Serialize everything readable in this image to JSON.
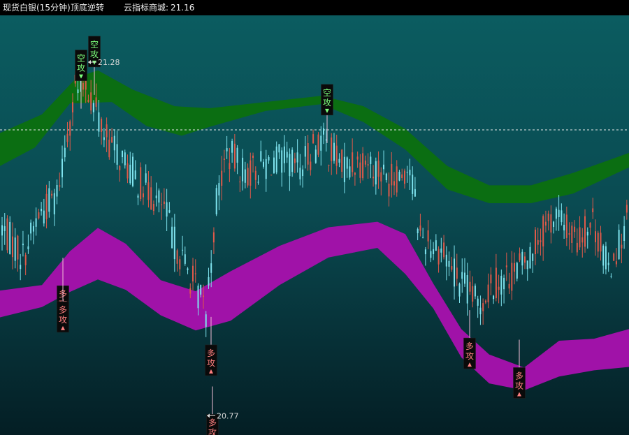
{
  "header": {
    "instrument": "现货白银(15分钟)",
    "indicator": "顶底逆转",
    "source_label": "云指标商城:",
    "source_value": "21.16"
  },
  "chart_data": {
    "type": "candlestick",
    "last_price": 21.16,
    "visible_high": 21.28,
    "visible_low": 20.77,
    "ylim": [
      20.74,
      21.35
    ],
    "grid": false,
    "colors": {
      "background_top": "#0b5c60",
      "background_bottom": "#041e24",
      "up_candle": "#e05a4a",
      "down_candle": "#7fe3ee",
      "upper_cloud": "#0b6e12",
      "lower_cloud": "#a012a8",
      "signal_text_bearish": "#7cff7c",
      "signal_text_bullish": "#ff8080",
      "signal_box": "#0a0a0a"
    },
    "upper_cloud": {
      "top": [
        [
          0,
          21.179
        ],
        [
          60,
          21.206
        ],
        [
          110,
          21.26
        ],
        [
          140,
          21.27
        ],
        [
          190,
          21.242
        ],
        [
          250,
          21.218
        ],
        [
          300,
          21.215
        ],
        [
          380,
          21.224
        ],
        [
          460,
          21.233
        ],
        [
          520,
          21.218
        ],
        [
          580,
          21.185
        ],
        [
          640,
          21.131
        ],
        [
          700,
          21.103
        ],
        [
          760,
          21.103
        ],
        [
          820,
          21.121
        ],
        [
          900,
          21.15
        ]
      ],
      "bottom": [
        [
          0,
          21.131
        ],
        [
          50,
          21.158
        ],
        [
          100,
          21.222
        ],
        [
          160,
          21.224
        ],
        [
          210,
          21.189
        ],
        [
          260,
          21.175
        ],
        [
          300,
          21.188
        ],
        [
          380,
          21.211
        ],
        [
          460,
          21.221
        ],
        [
          520,
          21.195
        ],
        [
          580,
          21.155
        ],
        [
          640,
          21.097
        ],
        [
          700,
          21.077
        ],
        [
          760,
          21.077
        ],
        [
          820,
          21.091
        ],
        [
          900,
          21.129
        ]
      ]
    },
    "lower_cloud": {
      "top": [
        [
          0,
          20.95
        ],
        [
          60,
          20.958
        ],
        [
          100,
          21.007
        ],
        [
          140,
          21.041
        ],
        [
          180,
          21.018
        ],
        [
          230,
          20.965
        ],
        [
          280,
          20.949
        ],
        [
          330,
          20.978
        ],
        [
          400,
          21.015
        ],
        [
          470,
          21.042
        ],
        [
          540,
          21.05
        ],
        [
          580,
          21.032
        ],
        [
          620,
          20.96
        ],
        [
          660,
          20.894
        ],
        [
          700,
          20.857
        ],
        [
          750,
          20.838
        ],
        [
          800,
          20.877
        ],
        [
          850,
          20.88
        ],
        [
          900,
          20.894
        ]
      ],
      "bottom": [
        [
          0,
          20.911
        ],
        [
          60,
          20.926
        ],
        [
          100,
          20.948
        ],
        [
          140,
          20.966
        ],
        [
          180,
          20.951
        ],
        [
          230,
          20.914
        ],
        [
          280,
          20.892
        ],
        [
          330,
          20.906
        ],
        [
          400,
          20.958
        ],
        [
          470,
          20.998
        ],
        [
          540,
          21.012
        ],
        [
          580,
          20.974
        ],
        [
          620,
          20.924
        ],
        [
          660,
          20.853
        ],
        [
          700,
          20.815
        ],
        [
          750,
          20.805
        ],
        [
          800,
          20.825
        ],
        [
          850,
          20.834
        ],
        [
          900,
          20.839
        ]
      ]
    },
    "candles": {
      "count": 240,
      "x_start": 3,
      "x_step": 3.74,
      "anchors": [
        [
          0,
          21.04
        ],
        [
          8,
          21.0
        ],
        [
          14,
          21.06
        ],
        [
          21,
          21.09
        ],
        [
          24,
          21.16
        ],
        [
          28,
          21.24
        ],
        [
          32,
          21.25
        ],
        [
          36,
          21.21
        ],
        [
          40,
          21.17
        ],
        [
          46,
          21.14
        ],
        [
          54,
          21.1
        ],
        [
          62,
          21.07
        ],
        [
          66,
          21.02
        ],
        [
          72,
          20.97
        ],
        [
          78,
          20.92
        ],
        [
          82,
          21.08
        ],
        [
          86,
          21.15
        ],
        [
          94,
          21.12
        ],
        [
          104,
          21.14
        ],
        [
          114,
          21.13
        ],
        [
          122,
          21.17
        ],
        [
          130,
          21.13
        ],
        [
          140,
          21.14
        ],
        [
          148,
          21.11
        ],
        [
          156,
          21.13
        ],
        [
          160,
          21.03
        ],
        [
          168,
          21.01
        ],
        [
          176,
          20.96
        ],
        [
          182,
          20.93
        ],
        [
          188,
          20.96
        ],
        [
          194,
          20.97
        ],
        [
          200,
          20.99
        ],
        [
          206,
          21.03
        ],
        [
          212,
          21.06
        ],
        [
          220,
          21.02
        ],
        [
          226,
          21.05
        ],
        [
          232,
          20.98
        ],
        [
          239,
          21.05
        ]
      ]
    },
    "signals": [
      {
        "label": "空",
        "type": "bearish",
        "price": 21.255,
        "side": "above",
        "x": 116
      },
      {
        "label": "空",
        "type": "bearish",
        "price": 21.275,
        "side": "above",
        "x": 135
      },
      {
        "label": "空",
        "type": "bearish",
        "price": 21.205,
        "side": "above",
        "x": 468
      },
      {
        "label": "多",
        "type": "bullish",
        "price": 20.957,
        "side": "below",
        "x": 90
      },
      {
        "label": "多",
        "type": "bullish",
        "price": 20.934,
        "side": "below",
        "x": 90
      },
      {
        "label": "多",
        "type": "bullish",
        "price": 20.871,
        "side": "below",
        "x": 302
      },
      {
        "label": "多",
        "type": "bullish",
        "price": 20.881,
        "side": "below",
        "x": 672
      },
      {
        "label": "多",
        "type": "bullish",
        "price": 20.838,
        "side": "below",
        "x": 743
      },
      {
        "label": "多",
        "type": "bullish",
        "price": 20.77,
        "side": "below",
        "x": 304
      }
    ],
    "signal_suffix": "攻",
    "extremes": [
      {
        "label": "21.28",
        "price": 21.282,
        "x": 126
      },
      {
        "label": "20.77",
        "price": 20.768,
        "x": 296
      }
    ]
  }
}
